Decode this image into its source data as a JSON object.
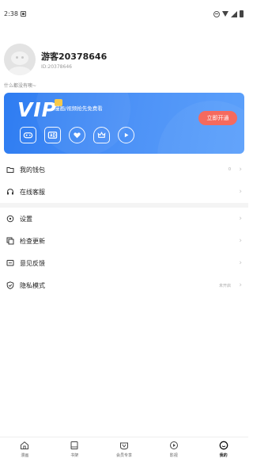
{
  "status_bar": {
    "time": "2:38"
  },
  "profile": {
    "nickname": "游客20378646",
    "user_id": "ID:20378646",
    "signature": "什么都没有噢~"
  },
  "vip_card": {
    "logo": "VIP",
    "description": "漫画/视频抢先免费看",
    "open_button": "立即开通",
    "benefits": [
      "gamepad-icon",
      "ad-free-icon",
      "heart-icon",
      "crown-icon",
      "play-icon"
    ]
  },
  "menu": {
    "wallet": {
      "label": "我的钱包",
      "value": "0"
    },
    "support": {
      "label": "在线客服"
    },
    "settings": {
      "label": "设置"
    },
    "update": {
      "label": "检查更新"
    },
    "feedback": {
      "label": "意见反馈"
    },
    "privacy": {
      "label": "隐私模式",
      "value": "未开启"
    }
  },
  "tabs": [
    {
      "label": "漫画",
      "icon": "home-icon"
    },
    {
      "label": "书架",
      "icon": "book-icon"
    },
    {
      "label": "会员专享",
      "icon": "vip-icon"
    },
    {
      "label": "影视",
      "icon": "video-icon"
    },
    {
      "label": "我的",
      "icon": "profile-icon"
    }
  ],
  "active_tab": 4,
  "colors": {
    "vip_card": "#3f89f4",
    "open_button": "#f56a5e"
  }
}
